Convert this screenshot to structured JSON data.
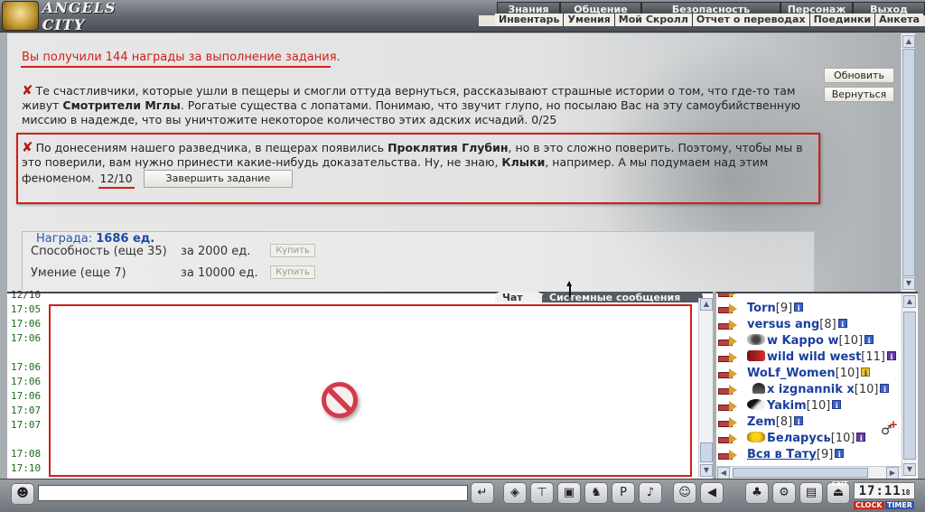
{
  "app": {
    "logo_text": "ANGELS CITY"
  },
  "main_menu": [
    "Знания",
    "Общение",
    "Безопасность",
    "Персонаж",
    "Выход"
  ],
  "sub_menu": [
    "Инвентарь",
    "Умения",
    "Мой Скролл",
    "Отчет о переводах",
    "Поединки",
    "Анкета"
  ],
  "quest_panel": {
    "reward_message": "Вы получили 144 награды за выполнение задания.",
    "quest1": {
      "text_a": "Те счастливчики, которые ушли в пещеры и смогли оттуда вернуться, рассказывают страшные истории о том, что где-то там живут ",
      "bold_a": "Смотрители Мглы",
      "text_b": ". Рогатые существа с лопатами. Понимаю, что звучит глупо, но посылаю Вас на эту самоубийственную миссию в надежде, что вы уничтожите некоторое количество этих адских исчадий. 0/25"
    },
    "quest2": {
      "text_a": "По донесениям нашего разведчика, в пещерах появились ",
      "bold_a": "Проклятия Глубин",
      "text_b": ", но в это сложно поверить. Поэтому, чтобы мы в это поверили, вам нужно принести какие-нибудь доказательства. Ну, не знаю, ",
      "bold_b": "Клыки",
      "text_c": ", например. А мы подумаем над этим феноменом.",
      "counter": "12/10",
      "finish_button": "Завершить задание"
    },
    "refresh_button": "Обновить",
    "return_button": "Вернуться",
    "reward": {
      "label": "Награда:",
      "value": "1686 ед.",
      "rows": [
        {
          "name": "Способность (еще 35)",
          "cost": "за 2000 ед.",
          "buy": "Купить"
        },
        {
          "name": "Умение (еще 7)",
          "cost": "за 10000 ед.",
          "buy": "Купить"
        }
      ]
    }
  },
  "chat": {
    "partial_line": "12/10",
    "times": [
      "17:05",
      "17:06",
      "17:06",
      "17:06",
      "17:06",
      "17:06",
      "17:07",
      "17:07",
      "17:08",
      "17:10"
    ],
    "tabs": [
      "Чат",
      "Системные сообщения"
    ]
  },
  "online_list": [
    {
      "name": "Torn",
      "level": "[9]",
      "info": "blue"
    },
    {
      "name": "versus ang",
      "level": "[8]",
      "info": "blue"
    },
    {
      "name": "w Kappo w",
      "level": "[10]",
      "info": "blue",
      "emblem": "fox"
    },
    {
      "name": "wild wild west",
      "level": "[11]",
      "info": "purple",
      "emblem": "red"
    },
    {
      "name": "WoLf_Women",
      "level": "[10]",
      "info": "yellow"
    },
    {
      "name": "x izgnannik x",
      "level": "[10]",
      "info": "blue",
      "emblem": "dark"
    },
    {
      "name": "Yakim",
      "level": "[10]",
      "info": "blue",
      "emblem": "wing"
    },
    {
      "name": "Zem",
      "level": "[8]",
      "info": "blue"
    },
    {
      "name": "Беларусь",
      "level": "[10]",
      "info": "purple",
      "emblem": "yellow"
    },
    {
      "name": "Вся в Тату",
      "level": "[9]",
      "info": "blue"
    }
  ],
  "toolbar": {
    "input_value": "",
    "clock_value": "17:11",
    "clock_seconds": "18",
    "clock_label": "CLOCK",
    "timer_label": "TIMER",
    "exit_label": "EXIT",
    "buttons": [
      "send-icon",
      "eraser-icon",
      "filter-icon",
      "save-icon",
      "fight-icon",
      "pl-icon",
      "music-icon",
      "smile-icon",
      "speaker-icon",
      "bag-icon",
      "gear-icon",
      "lock-icon",
      "exit-icon"
    ]
  },
  "colors": {
    "accent_red": "#d21f16",
    "nick_blue": "#1a3f9e",
    "time_green": "#1a6a1a"
  }
}
